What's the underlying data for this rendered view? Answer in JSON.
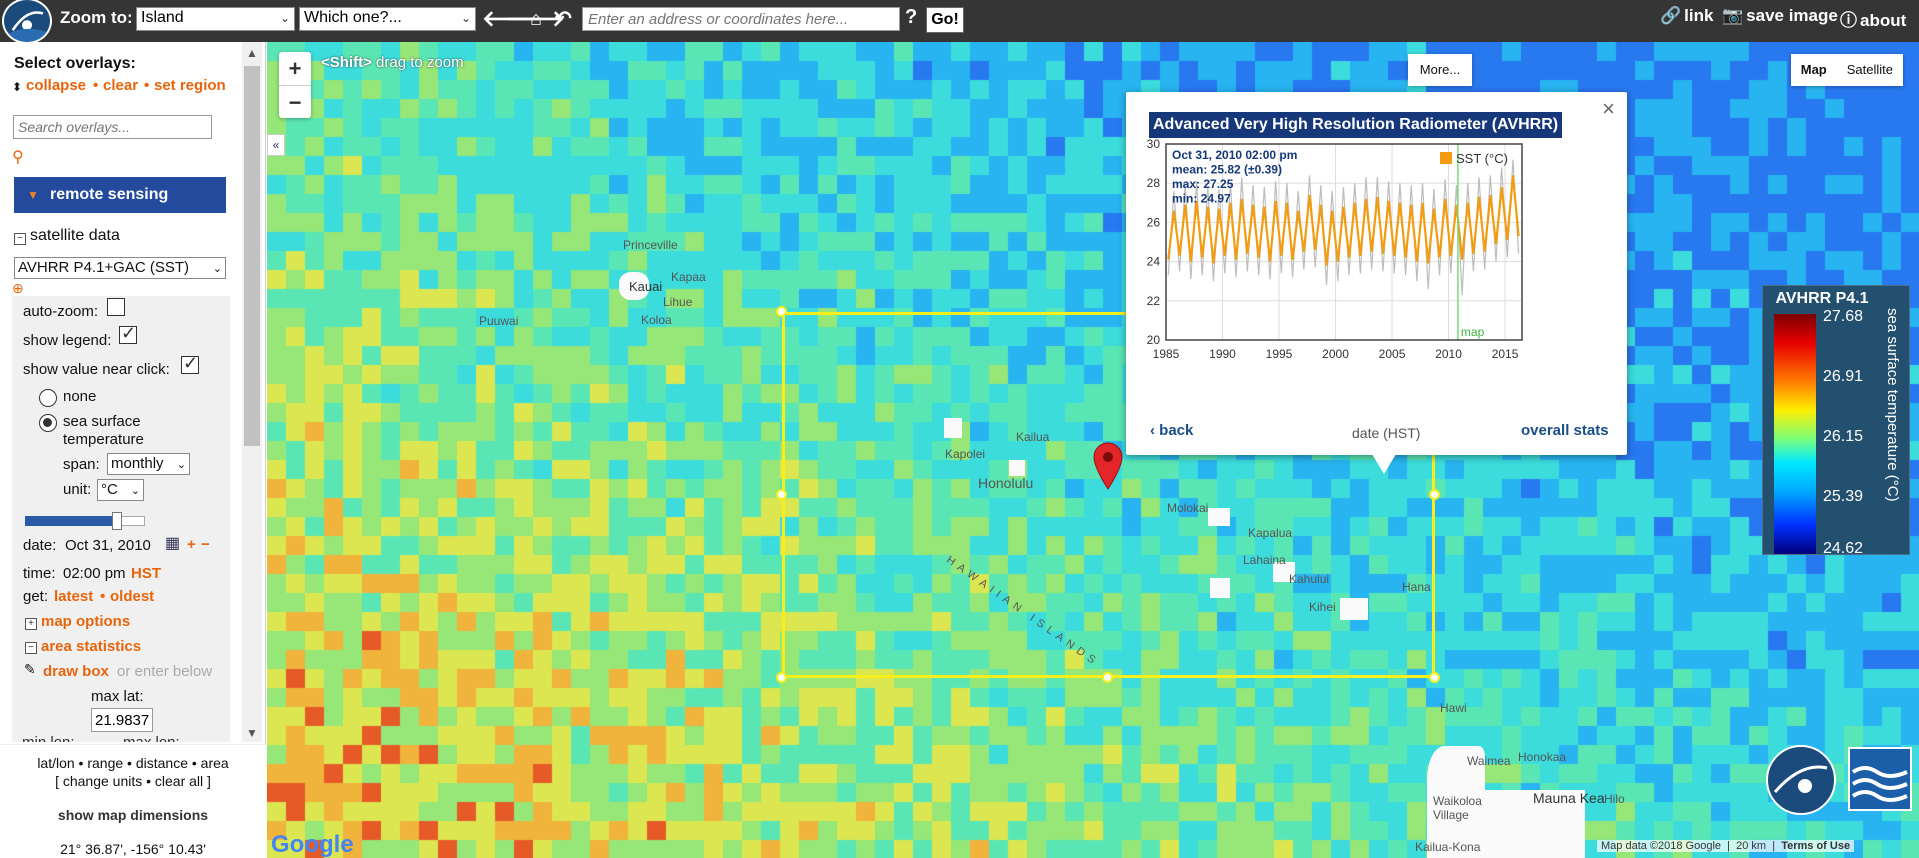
{
  "topbar": {
    "zoom_to_label": "Zoom to:",
    "zoom_select": "Island",
    "which_select": "Which one?...",
    "address_placeholder": "Enter an address or coordinates here...",
    "help": "?",
    "go_label": "Go!",
    "link_label": "link",
    "save_image_label": "save image",
    "about_label": "about"
  },
  "sidebar": {
    "select_overlays": "Select overlays:",
    "collapse": "collapse",
    "clear": "clear",
    "set_region": "set region",
    "search_placeholder": "Search overlays...",
    "remote_sensing": "remote sensing",
    "satellite_data": "satellite data",
    "dataset_select": "AVHRR P4.1+GAC (SST)",
    "auto_zoom": "auto-zoom:",
    "auto_zoom_checked": false,
    "show_legend": "show legend:",
    "show_legend_checked": true,
    "show_value": "show value near click:",
    "show_value_checked": true,
    "radio_none": "none",
    "radio_sst_1": "sea surface",
    "radio_sst_2": "temperature",
    "span_label": "span:",
    "span_value": "monthly",
    "unit_label": "unit:",
    "unit_value": "°C",
    "opacity_fraction": 0.77,
    "date_label": "date:",
    "date_value": "Oct 31, 2010",
    "date_plus": "+",
    "date_minus": "−",
    "time_label": "time:",
    "time_value": "02:00 pm",
    "time_zone": "HST",
    "get_label": "get:",
    "latest": "latest",
    "oldest": "oldest",
    "map_options": "map options",
    "area_statistics": "area statistics",
    "draw_box": "draw box",
    "or_enter_below": "or enter below",
    "max_lat_label": "max lat:",
    "max_lat_value": "21.9837",
    "min_lon_label": "min lon:",
    "max_lon_label": "max lon:"
  },
  "footer": {
    "line1": "lat/lon • range • distance • area",
    "line2": "[ change units • clear all ]",
    "show_dimensions": "show map dimensions",
    "coords": "21° 36.87', -156° 10.43'"
  },
  "map": {
    "shift_hint_key": "<Shift>",
    "shift_hint_text": "drag to zoom",
    "zoom_in": "+",
    "zoom_out": "−",
    "more": "More...",
    "map_btn": "Map",
    "satellite_btn": "Satellite",
    "attribution": "Map data ©2018 Google",
    "scale": "20 km",
    "terms": "Terms of Use",
    "google": "Google",
    "places": [
      {
        "name": "Princeville"
      },
      {
        "name": "Kauai"
      },
      {
        "name": "Kapaa"
      },
      {
        "name": "Lihue"
      },
      {
        "name": "Koloa"
      },
      {
        "name": "Puuwai"
      },
      {
        "name": "Kailua"
      },
      {
        "name": "Kapolei"
      },
      {
        "name": "Honolulu"
      },
      {
        "name": "Molokai"
      },
      {
        "name": "Kapalua"
      },
      {
        "name": "Lahaina"
      },
      {
        "name": "Kahului"
      },
      {
        "name": "Hana"
      },
      {
        "name": "Kihei"
      },
      {
        "name": "HAWAIIAN ISLANDS"
      },
      {
        "name": "Hawi"
      },
      {
        "name": "Waimea"
      },
      {
        "name": "Honokaa"
      },
      {
        "name": "Mauna Kea"
      },
      {
        "name": "Waikoloa Village"
      },
      {
        "name": "Hilo"
      },
      {
        "name": "Kailua-Kona"
      }
    ]
  },
  "legend": {
    "title": "AVHRR P4.1",
    "ticks": [
      "27.68",
      "26.91",
      "26.15",
      "25.39",
      "24.62"
    ],
    "vertical_label": "sea surface temperature (°C)"
  },
  "popup": {
    "title": "Advanced Very High Resolution Radiometer (AVHRR)",
    "close": "×",
    "back": "back",
    "overall_stats": "overall stats",
    "stat_date": "Oct 31, 2010 02:00 pm",
    "stat_mean": "mean: 25.82 (±0.39)",
    "stat_max": "max:   27.25",
    "stat_min": "min:   24.97",
    "map_marker_label": "map"
  },
  "chart_data": {
    "type": "line",
    "xlabel": "date (HST)",
    "ylabel": "",
    "xlim": [
      1985,
      2016.5
    ],
    "ylim": [
      20,
      30
    ],
    "xticks": [
      1985,
      1990,
      1995,
      2000,
      2005,
      2010,
      2015
    ],
    "yticks": [
      20,
      22,
      24,
      26,
      28,
      30
    ],
    "legend": "top-right",
    "grid": true,
    "marker_x": 2010.83,
    "series": [
      {
        "name": "SST (°C)",
        "color": "#f39c12",
        "x": [
          1985.2,
          1985.7,
          1986.2,
          1986.7,
          1987.2,
          1987.7,
          1988.2,
          1988.7,
          1989.2,
          1989.7,
          1990.2,
          1990.7,
          1991.2,
          1991.7,
          1992.2,
          1992.7,
          1993.2,
          1993.7,
          1994.2,
          1994.7,
          1995.2,
          1995.7,
          1996.2,
          1996.7,
          1997.2,
          1997.7,
          1998.2,
          1998.7,
          1999.2,
          1999.7,
          2000.2,
          2000.7,
          2001.2,
          2001.7,
          2002.2,
          2002.7,
          2003.2,
          2003.7,
          2004.2,
          2004.7,
          2005.2,
          2005.7,
          2006.2,
          2006.7,
          2007.2,
          2007.7,
          2008.2,
          2008.7,
          2009.2,
          2009.7,
          2010.2,
          2010.7,
          2011.2,
          2011.7,
          2012.2,
          2012.7,
          2013.2,
          2013.7,
          2014.2,
          2014.7,
          2015.2,
          2015.7,
          2016.2
        ],
        "values": [
          24.1,
          26.6,
          24.3,
          26.9,
          24.0,
          27.1,
          24.2,
          26.8,
          23.9,
          26.7,
          24.3,
          27.0,
          24.1,
          27.2,
          24.4,
          26.9,
          24.2,
          26.8,
          24.0,
          27.1,
          24.3,
          27.0,
          24.1,
          26.6,
          24.5,
          27.4,
          24.6,
          26.9,
          23.8,
          26.6,
          24.0,
          26.8,
          24.2,
          27.0,
          24.3,
          27.2,
          24.5,
          27.3,
          24.4,
          27.1,
          24.3,
          27.0,
          24.2,
          26.9,
          24.0,
          27.0,
          23.9,
          26.7,
          24.2,
          27.2,
          24.3,
          26.9,
          24.1,
          27.0,
          24.4,
          27.3,
          24.5,
          27.4,
          24.9,
          27.8,
          25.1,
          28.4,
          25.3
        ]
      },
      {
        "name": "",
        "color": "#bdbdbd",
        "x": [
          1985.2,
          1985.7,
          1986.2,
          1986.7,
          1987.2,
          1987.7,
          1988.2,
          1988.7,
          1989.2,
          1989.7,
          1990.2,
          1990.7,
          1991.2,
          1991.7,
          1992.2,
          1992.7,
          1993.2,
          1993.7,
          1994.2,
          1994.7,
          1995.2,
          1995.7,
          1996.2,
          1996.7,
          1997.2,
          1997.7,
          1998.2,
          1998.7,
          1999.2,
          1999.7,
          2000.2,
          2000.7,
          2001.2,
          2001.7,
          2002.2,
          2002.7,
          2003.2,
          2003.7,
          2004.2,
          2004.7,
          2005.2,
          2005.7,
          2006.2,
          2006.7,
          2007.2,
          2007.7,
          2008.2,
          2008.7,
          2009.2,
          2009.7,
          2010.2,
          2010.7,
          2011.2,
          2011.7,
          2012.2,
          2012.7,
          2013.2,
          2013.7,
          2014.2,
          2014.7,
          2015.2,
          2015.7,
          2016.2
        ],
        "values": [
          23.3,
          27.6,
          23.5,
          27.9,
          23.1,
          28.1,
          23.3,
          27.8,
          23.0,
          27.7,
          23.4,
          28.0,
          23.2,
          28.3,
          23.5,
          27.9,
          23.3,
          27.8,
          23.1,
          28.1,
          23.4,
          28.0,
          23.2,
          27.6,
          23.6,
          28.4,
          23.7,
          27.9,
          22.8,
          27.6,
          23.0,
          27.8,
          23.3,
          28.0,
          23.4,
          28.3,
          23.6,
          28.3,
          23.5,
          28.1,
          23.4,
          28.0,
          23.3,
          27.9,
          23.0,
          28.0,
          22.6,
          27.7,
          23.3,
          28.2,
          23.4,
          27.9,
          22.3,
          28.0,
          23.5,
          28.3,
          23.6,
          28.4,
          24.0,
          28.8,
          24.2,
          29.2,
          24.4
        ]
      }
    ]
  }
}
